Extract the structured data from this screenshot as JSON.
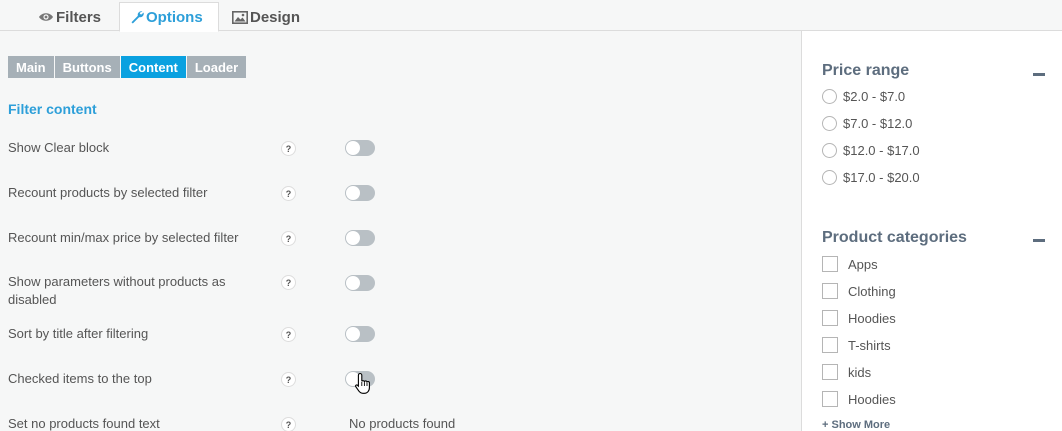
{
  "tabs": {
    "filters": "Filters",
    "options": "Options",
    "design": "Design"
  },
  "subtabs": [
    "Main",
    "Buttons",
    "Content",
    "Loader"
  ],
  "active_subtab": "Content",
  "section_title": "Filter content",
  "settings": [
    {
      "label": "Show Clear block",
      "help": "?",
      "enabled": false
    },
    {
      "label": "Recount products by selected filter",
      "help": "?",
      "enabled": false
    },
    {
      "label": "Recount min/max price by selected filter",
      "help": "?",
      "enabled": false
    },
    {
      "label": "Show parameters without products as disabled",
      "help": "?",
      "enabled": false
    },
    {
      "label": "Sort by title after filtering",
      "help": "?",
      "enabled": false
    },
    {
      "label": "Checked items to the top",
      "help": "?",
      "enabled": false
    },
    {
      "label": "Set no products found text",
      "help": "?",
      "value": "No products found"
    }
  ],
  "sidebar": {
    "price_range": {
      "title": "Price range",
      "options": [
        "$2.0 - $7.0",
        "$7.0 - $12.0",
        "$12.0 - $17.0",
        "$17.0 - $20.0"
      ]
    },
    "categories": {
      "title": "Product categories",
      "items": [
        "Apps",
        "Clothing",
        "Hoodies",
        "T-shirts",
        "kids",
        "Hoodies"
      ],
      "show_more": "+ Show More"
    }
  },
  "colors": {
    "accent": "#0aa1e0",
    "subtab_inactive": "#a6b0b7",
    "toggle_off": "#b9c0c5"
  },
  "icons": {
    "filters": "eye-icon",
    "options": "wrench-icon",
    "design": "image-icon"
  }
}
